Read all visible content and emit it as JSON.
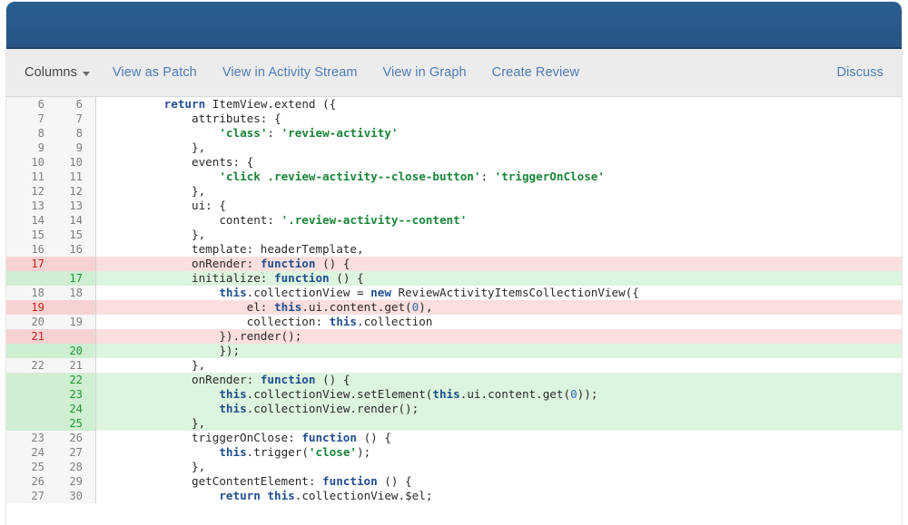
{
  "header": {
    "bar_color": "#295a8b"
  },
  "toolbar": {
    "columns_label": "Columns",
    "view_as_patch_label": "View as Patch",
    "view_in_activity_stream_label": "View in Activity Stream",
    "view_in_graph_label": "View in Graph",
    "create_review_label": "Create Review",
    "discuss_label": "Discuss"
  },
  "diff": {
    "colors": {
      "added_bg": "#ddf4df",
      "added_gutter": "#cfeed2",
      "removed_bg": "#fbdede",
      "removed_gutter": "#f7d2d2",
      "context_gutter": "#f6f6f6",
      "keyword": "#1f4f8f",
      "string": "#1a8437",
      "number": "#2b6cb8"
    },
    "rows": [
      {
        "old": "6",
        "new": "6",
        "type": "context",
        "tokens": [
          {
            "t": "        ",
            "c": "pl"
          },
          {
            "t": "return",
            "c": "kw"
          },
          {
            "t": " ItemView.extend ({",
            "c": "pl"
          }
        ]
      },
      {
        "old": "7",
        "new": "7",
        "type": "context",
        "tokens": [
          {
            "t": "            attributes: {",
            "c": "pl"
          }
        ]
      },
      {
        "old": "8",
        "new": "8",
        "type": "context",
        "tokens": [
          {
            "t": "                ",
            "c": "pl"
          },
          {
            "t": "'class'",
            "c": "str"
          },
          {
            "t": ": ",
            "c": "pl"
          },
          {
            "t": "'review-activity'",
            "c": "str"
          }
        ]
      },
      {
        "old": "9",
        "new": "9",
        "type": "context",
        "tokens": [
          {
            "t": "            },",
            "c": "pl"
          }
        ]
      },
      {
        "old": "10",
        "new": "10",
        "type": "context",
        "tokens": [
          {
            "t": "            events: {",
            "c": "pl"
          }
        ]
      },
      {
        "old": "11",
        "new": "11",
        "type": "context",
        "tokens": [
          {
            "t": "                ",
            "c": "pl"
          },
          {
            "t": "'click .review-activity--close-button'",
            "c": "str"
          },
          {
            "t": ": ",
            "c": "pl"
          },
          {
            "t": "'triggerOnClose'",
            "c": "str"
          }
        ]
      },
      {
        "old": "12",
        "new": "12",
        "type": "context",
        "tokens": [
          {
            "t": "            },",
            "c": "pl"
          }
        ]
      },
      {
        "old": "13",
        "new": "13",
        "type": "context",
        "tokens": [
          {
            "t": "            ui: {",
            "c": "pl"
          }
        ]
      },
      {
        "old": "14",
        "new": "14",
        "type": "context",
        "tokens": [
          {
            "t": "                content: ",
            "c": "pl"
          },
          {
            "t": "'.review-activity--content'",
            "c": "str"
          }
        ]
      },
      {
        "old": "15",
        "new": "15",
        "type": "context",
        "tokens": [
          {
            "t": "            },",
            "c": "pl"
          }
        ]
      },
      {
        "old": "16",
        "new": "16",
        "type": "context",
        "tokens": [
          {
            "t": "            template: headerTemplate,",
            "c": "pl"
          }
        ]
      },
      {
        "old": "17",
        "new": "",
        "type": "removed",
        "tokens": [
          {
            "t": "            onRender: ",
            "c": "pl"
          },
          {
            "t": "function",
            "c": "kw"
          },
          {
            "t": " () {",
            "c": "pl"
          }
        ]
      },
      {
        "old": "",
        "new": "17",
        "type": "added",
        "tokens": [
          {
            "t": "            initialize: ",
            "c": "pl"
          },
          {
            "t": "function",
            "c": "kw"
          },
          {
            "t": " () {",
            "c": "pl"
          }
        ]
      },
      {
        "old": "18",
        "new": "18",
        "type": "context",
        "tokens": [
          {
            "t": "                ",
            "c": "pl"
          },
          {
            "t": "this",
            "c": "kw"
          },
          {
            "t": ".collectionView = ",
            "c": "pl"
          },
          {
            "t": "new",
            "c": "kw"
          },
          {
            "t": " ReviewActivityItemsCollectionView({",
            "c": "pl"
          }
        ]
      },
      {
        "old": "19",
        "new": "",
        "type": "removed",
        "tokens": [
          {
            "t": "                    el: ",
            "c": "pl"
          },
          {
            "t": "this",
            "c": "kw"
          },
          {
            "t": ".ui.content.get(",
            "c": "pl"
          },
          {
            "t": "0",
            "c": "num"
          },
          {
            "t": "),",
            "c": "pl"
          }
        ]
      },
      {
        "old": "20",
        "new": "19",
        "type": "context",
        "tokens": [
          {
            "t": "                    collection: ",
            "c": "pl"
          },
          {
            "t": "this",
            "c": "kw"
          },
          {
            "t": ".collection",
            "c": "pl"
          }
        ]
      },
      {
        "old": "21",
        "new": "",
        "type": "removed",
        "tokens": [
          {
            "t": "                }).render();",
            "c": "pl"
          }
        ]
      },
      {
        "old": "",
        "new": "20",
        "type": "added",
        "tokens": [
          {
            "t": "                });",
            "c": "pl"
          }
        ]
      },
      {
        "old": "22",
        "new": "21",
        "type": "context",
        "tokens": [
          {
            "t": "            },",
            "c": "pl"
          }
        ]
      },
      {
        "old": "",
        "new": "22",
        "type": "added",
        "tokens": [
          {
            "t": "            onRender: ",
            "c": "pl"
          },
          {
            "t": "function",
            "c": "kw"
          },
          {
            "t": " () {",
            "c": "pl"
          }
        ]
      },
      {
        "old": "",
        "new": "23",
        "type": "added",
        "tokens": [
          {
            "t": "                ",
            "c": "pl"
          },
          {
            "t": "this",
            "c": "kw"
          },
          {
            "t": ".collectionView.setElement(",
            "c": "pl"
          },
          {
            "t": "this",
            "c": "kw"
          },
          {
            "t": ".ui.content.get(",
            "c": "pl"
          },
          {
            "t": "0",
            "c": "num"
          },
          {
            "t": "));",
            "c": "pl"
          }
        ]
      },
      {
        "old": "",
        "new": "24",
        "type": "added",
        "tokens": [
          {
            "t": "                ",
            "c": "pl"
          },
          {
            "t": "this",
            "c": "kw"
          },
          {
            "t": ".collectionView.render();",
            "c": "pl"
          }
        ]
      },
      {
        "old": "",
        "new": "25",
        "type": "added",
        "tokens": [
          {
            "t": "            },",
            "c": "pl"
          }
        ]
      },
      {
        "old": "23",
        "new": "26",
        "type": "context",
        "tokens": [
          {
            "t": "            triggerOnClose: ",
            "c": "pl"
          },
          {
            "t": "function",
            "c": "kw"
          },
          {
            "t": " () {",
            "c": "pl"
          }
        ]
      },
      {
        "old": "24",
        "new": "27",
        "type": "context",
        "tokens": [
          {
            "t": "                ",
            "c": "pl"
          },
          {
            "t": "this",
            "c": "kw"
          },
          {
            "t": ".trigger(",
            "c": "pl"
          },
          {
            "t": "'close'",
            "c": "str"
          },
          {
            "t": ");",
            "c": "pl"
          }
        ]
      },
      {
        "old": "25",
        "new": "28",
        "type": "context",
        "tokens": [
          {
            "t": "            },",
            "c": "pl"
          }
        ]
      },
      {
        "old": "26",
        "new": "29",
        "type": "context",
        "tokens": [
          {
            "t": "            getContentElement: ",
            "c": "pl"
          },
          {
            "t": "function",
            "c": "kw"
          },
          {
            "t": " () {",
            "c": "pl"
          }
        ]
      },
      {
        "old": "27",
        "new": "30",
        "type": "context",
        "tokens": [
          {
            "t": "                ",
            "c": "pl"
          },
          {
            "t": "return",
            "c": "kw"
          },
          {
            "t": " ",
            "c": "pl"
          },
          {
            "t": "this",
            "c": "kw"
          },
          {
            "t": ".collectionView.$el;",
            "c": "pl"
          }
        ]
      }
    ]
  }
}
